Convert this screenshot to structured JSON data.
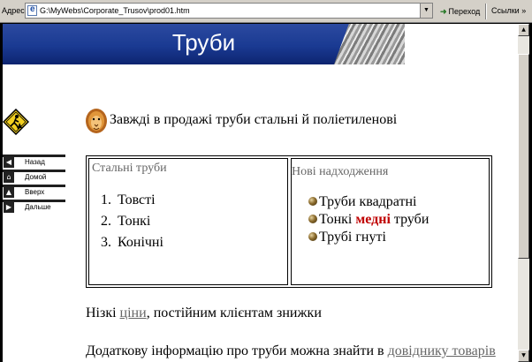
{
  "address_bar": {
    "label": "Адрес",
    "url": "G:\\MyWebs\\Corporate_Trusov\\prod01.htm",
    "go_label": "Переход",
    "links_label": "Ссылки",
    "dropdown_glyph": "▼",
    "links_glyph": "»"
  },
  "scrollbar": {
    "up_glyph": "▲",
    "down_glyph": "▼"
  },
  "banner": {
    "title": "Труби"
  },
  "nav": {
    "back": "Назад",
    "home": "Домой",
    "up": "Вверх",
    "next": "Дальше"
  },
  "headline": "Завжді в продажі труби стальні й поліетиленові",
  "table": {
    "left_head": "Стальні труби",
    "steel_items": [
      {
        "num": "1.",
        "text": "Товсті"
      },
      {
        "num": "2.",
        "text": "Тонкі"
      },
      {
        "num": "3.",
        "text": "Конічні"
      }
    ],
    "right_head": "Нові надходження",
    "new_items": [
      "Труби квадратні",
      {
        "before": "Тонкі ",
        "highlight": "медні",
        "after": " труби"
      },
      "Трубі гнуті"
    ]
  },
  "para1": {
    "before": "Нізкі ",
    "link": "ціни",
    "after": ", постійним клієнтам знижки"
  },
  "para2": {
    "before": "Додаткову інформацію про труби можна знайти в ",
    "link": "довіднику  товарів"
  },
  "colors": {
    "banner_blue": "#1a3a92",
    "highlight_red": "#c00000",
    "link_gray": "#666666"
  }
}
